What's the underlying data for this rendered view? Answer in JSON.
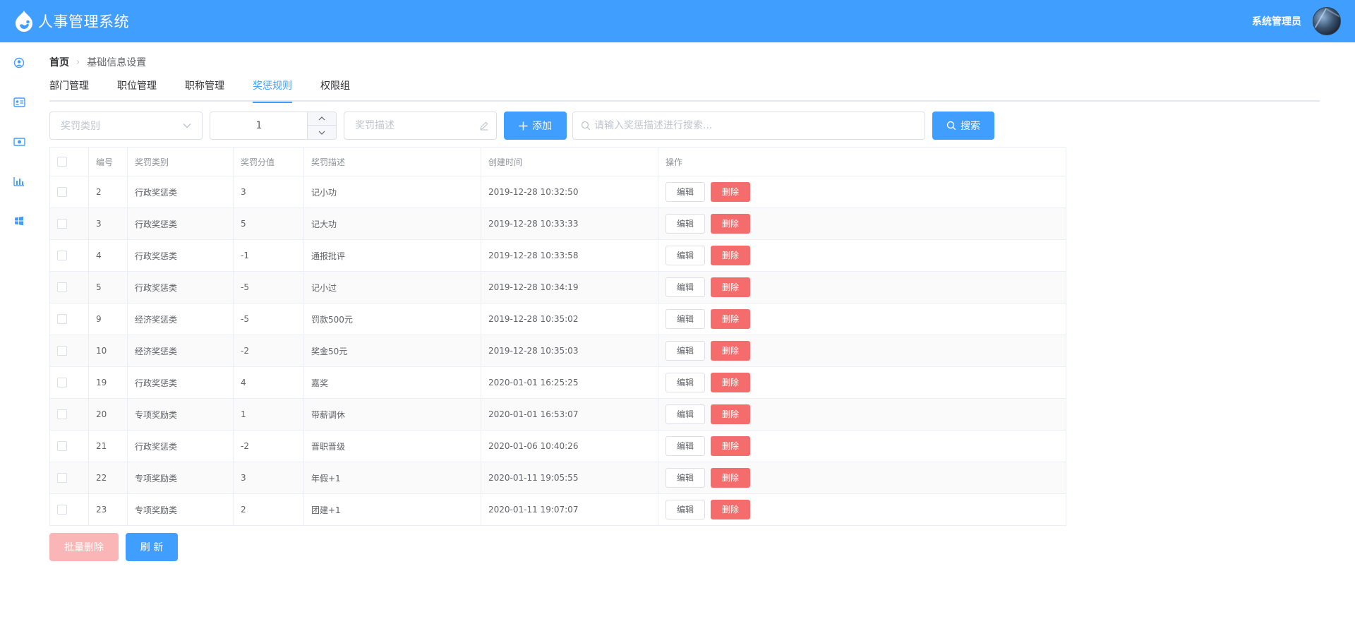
{
  "app": {
    "title": "人事管理系统",
    "user_name": "系统管理员"
  },
  "sidebar": {
    "items": [
      {
        "icon": "user-circle-icon"
      },
      {
        "icon": "id-card-icon"
      },
      {
        "icon": "money-icon"
      },
      {
        "icon": "bar-chart-icon"
      },
      {
        "icon": "windows-icon"
      }
    ]
  },
  "breadcrumb": {
    "home": "首页",
    "current": "基础信息设置"
  },
  "tabs": [
    {
      "label": "部门管理",
      "active": false
    },
    {
      "label": "职位管理",
      "active": false
    },
    {
      "label": "职称管理",
      "active": false
    },
    {
      "label": "奖惩规则",
      "active": true
    },
    {
      "label": "权限组",
      "active": false
    }
  ],
  "toolbar": {
    "category_placeholder": "奖罚类别",
    "score_value": "1",
    "desc_placeholder": "奖罚描述",
    "add_label": "添加",
    "search_placeholder": "请输入奖惩描述进行搜索...",
    "search_label": "搜索"
  },
  "table": {
    "columns": [
      "编号",
      "奖罚类别",
      "奖罚分值",
      "奖罚描述",
      "创建时间",
      "操作"
    ],
    "edit_label": "编辑",
    "delete_label": "删除",
    "rows": [
      {
        "id": "2",
        "category": "行政奖惩类",
        "score": "3",
        "desc": "记小功",
        "created": "2019-12-28 10:32:50"
      },
      {
        "id": "3",
        "category": "行政奖惩类",
        "score": "5",
        "desc": "记大功",
        "created": "2019-12-28 10:33:33"
      },
      {
        "id": "4",
        "category": "行政奖惩类",
        "score": "-1",
        "desc": "通报批评",
        "created": "2019-12-28 10:33:58"
      },
      {
        "id": "5",
        "category": "行政奖惩类",
        "score": "-5",
        "desc": "记小过",
        "created": "2019-12-28 10:34:19"
      },
      {
        "id": "9",
        "category": "经济奖惩类",
        "score": "-5",
        "desc": "罚款500元",
        "created": "2019-12-28 10:35:02"
      },
      {
        "id": "10",
        "category": "经济奖惩类",
        "score": "-2",
        "desc": "奖金50元",
        "created": "2019-12-28 10:35:03"
      },
      {
        "id": "19",
        "category": "行政奖惩类",
        "score": "4",
        "desc": "嘉奖",
        "created": "2020-01-01 16:25:25"
      },
      {
        "id": "20",
        "category": "专项奖励类",
        "score": "1",
        "desc": "带薪调休",
        "created": "2020-01-01 16:53:07"
      },
      {
        "id": "21",
        "category": "行政奖惩类",
        "score": "-2",
        "desc": "晋职晋级",
        "created": "2020-01-06 10:40:26"
      },
      {
        "id": "22",
        "category": "专项奖励类",
        "score": "3",
        "desc": "年假+1",
        "created": "2020-01-11 19:05:55"
      },
      {
        "id": "23",
        "category": "专项奖励类",
        "score": "2",
        "desc": "团建+1",
        "created": "2020-01-11 19:07:07"
      }
    ]
  },
  "footer": {
    "batch_delete_label": "批量删除",
    "refresh_label": "刷 新"
  },
  "colors": {
    "primary": "#409eff",
    "danger": "#f56c6c",
    "danger_disabled": "#fab6b6"
  }
}
